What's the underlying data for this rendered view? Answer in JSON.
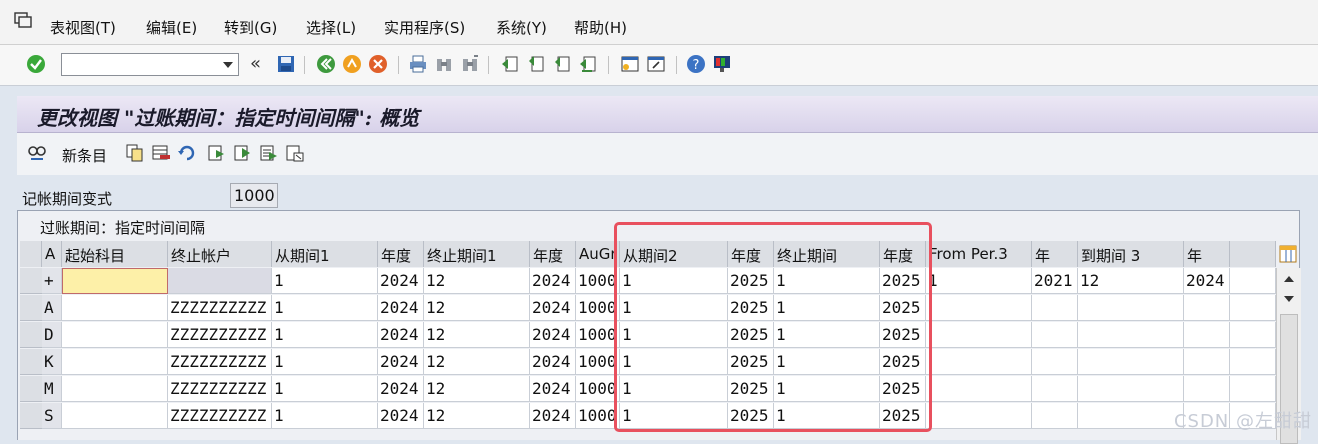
{
  "menu": [
    {
      "label": "表视图(T)"
    },
    {
      "label": "编辑(E)"
    },
    {
      "label": "转到(G)"
    },
    {
      "label": "选择(L)"
    },
    {
      "label": "实用程序(S)"
    },
    {
      "label": "系统(Y)"
    },
    {
      "label": "帮助(H)"
    }
  ],
  "toolbar": {
    "command_value": "",
    "back_chevrons": "«"
  },
  "page": {
    "title": "更改视图 \"过账期间：指定时间间隔\": 概览"
  },
  "app_toolbar": {
    "new_entries_label": "新条目"
  },
  "variant": {
    "label": "记帐期间变式",
    "value": "1000"
  },
  "table": {
    "title": "过账期间：指定时间间隔",
    "columns": [
      "A",
      "起始科目",
      "终止帐户",
      "从期间1",
      "年度",
      "终止期间1",
      "年度",
      "AuGr",
      "从期间2",
      "年度",
      "终止期间",
      "年度",
      "From Per.3",
      "年",
      "到期间 3",
      "年"
    ],
    "rows": [
      {
        "type": "+",
        "from_acct": "",
        "to_acct": "",
        "p1_from": "1",
        "y1": "2024",
        "p1_to": "12",
        "y1_to": "2024",
        "augr": "1000",
        "p2_from": "1",
        "y2": "2025",
        "p2_to": "1",
        "y2_to": "2025",
        "p3_from": "1",
        "y3": "2021",
        "p3_to": "12",
        "y3_to": "2024"
      },
      {
        "type": "A",
        "from_acct": "",
        "to_acct": "ZZZZZZZZZZ",
        "p1_from": "1",
        "y1": "2024",
        "p1_to": "12",
        "y1_to": "2024",
        "augr": "1000",
        "p2_from": "1",
        "y2": "2025",
        "p2_to": "1",
        "y2_to": "2025",
        "p3_from": "",
        "y3": "",
        "p3_to": "",
        "y3_to": ""
      },
      {
        "type": "D",
        "from_acct": "",
        "to_acct": "ZZZZZZZZZZ",
        "p1_from": "1",
        "y1": "2024",
        "p1_to": "12",
        "y1_to": "2024",
        "augr": "1000",
        "p2_from": "1",
        "y2": "2025",
        "p2_to": "1",
        "y2_to": "2025",
        "p3_from": "",
        "y3": "",
        "p3_to": "",
        "y3_to": ""
      },
      {
        "type": "K",
        "from_acct": "",
        "to_acct": "ZZZZZZZZZZ",
        "p1_from": "1",
        "y1": "2024",
        "p1_to": "12",
        "y1_to": "2024",
        "augr": "1000",
        "p2_from": "1",
        "y2": "2025",
        "p2_to": "1",
        "y2_to": "2025",
        "p3_from": "",
        "y3": "",
        "p3_to": "",
        "y3_to": ""
      },
      {
        "type": "M",
        "from_acct": "",
        "to_acct": "ZZZZZZZZZZ",
        "p1_from": "1",
        "y1": "2024",
        "p1_to": "12",
        "y1_to": "2024",
        "augr": "1000",
        "p2_from": "1",
        "y2": "2025",
        "p2_to": "1",
        "y2_to": "2025",
        "p3_from": "",
        "y3": "",
        "p3_to": "",
        "y3_to": ""
      },
      {
        "type": "S",
        "from_acct": "",
        "to_acct": "ZZZZZZZZZZ",
        "p1_from": "1",
        "y1": "2024",
        "p1_to": "12",
        "y1_to": "2024",
        "augr": "1000",
        "p2_from": "1",
        "y2": "2025",
        "p2_to": "1",
        "y2_to": "2025",
        "p3_from": "",
        "y3": "",
        "p3_to": "",
        "y3_to": ""
      }
    ]
  },
  "watermark": "CSDN @左甜甜",
  "colors": {
    "highlight": "#e8505e",
    "title_bg": "#d8d2ea",
    "new_row_cell": "#fdf0a8"
  }
}
